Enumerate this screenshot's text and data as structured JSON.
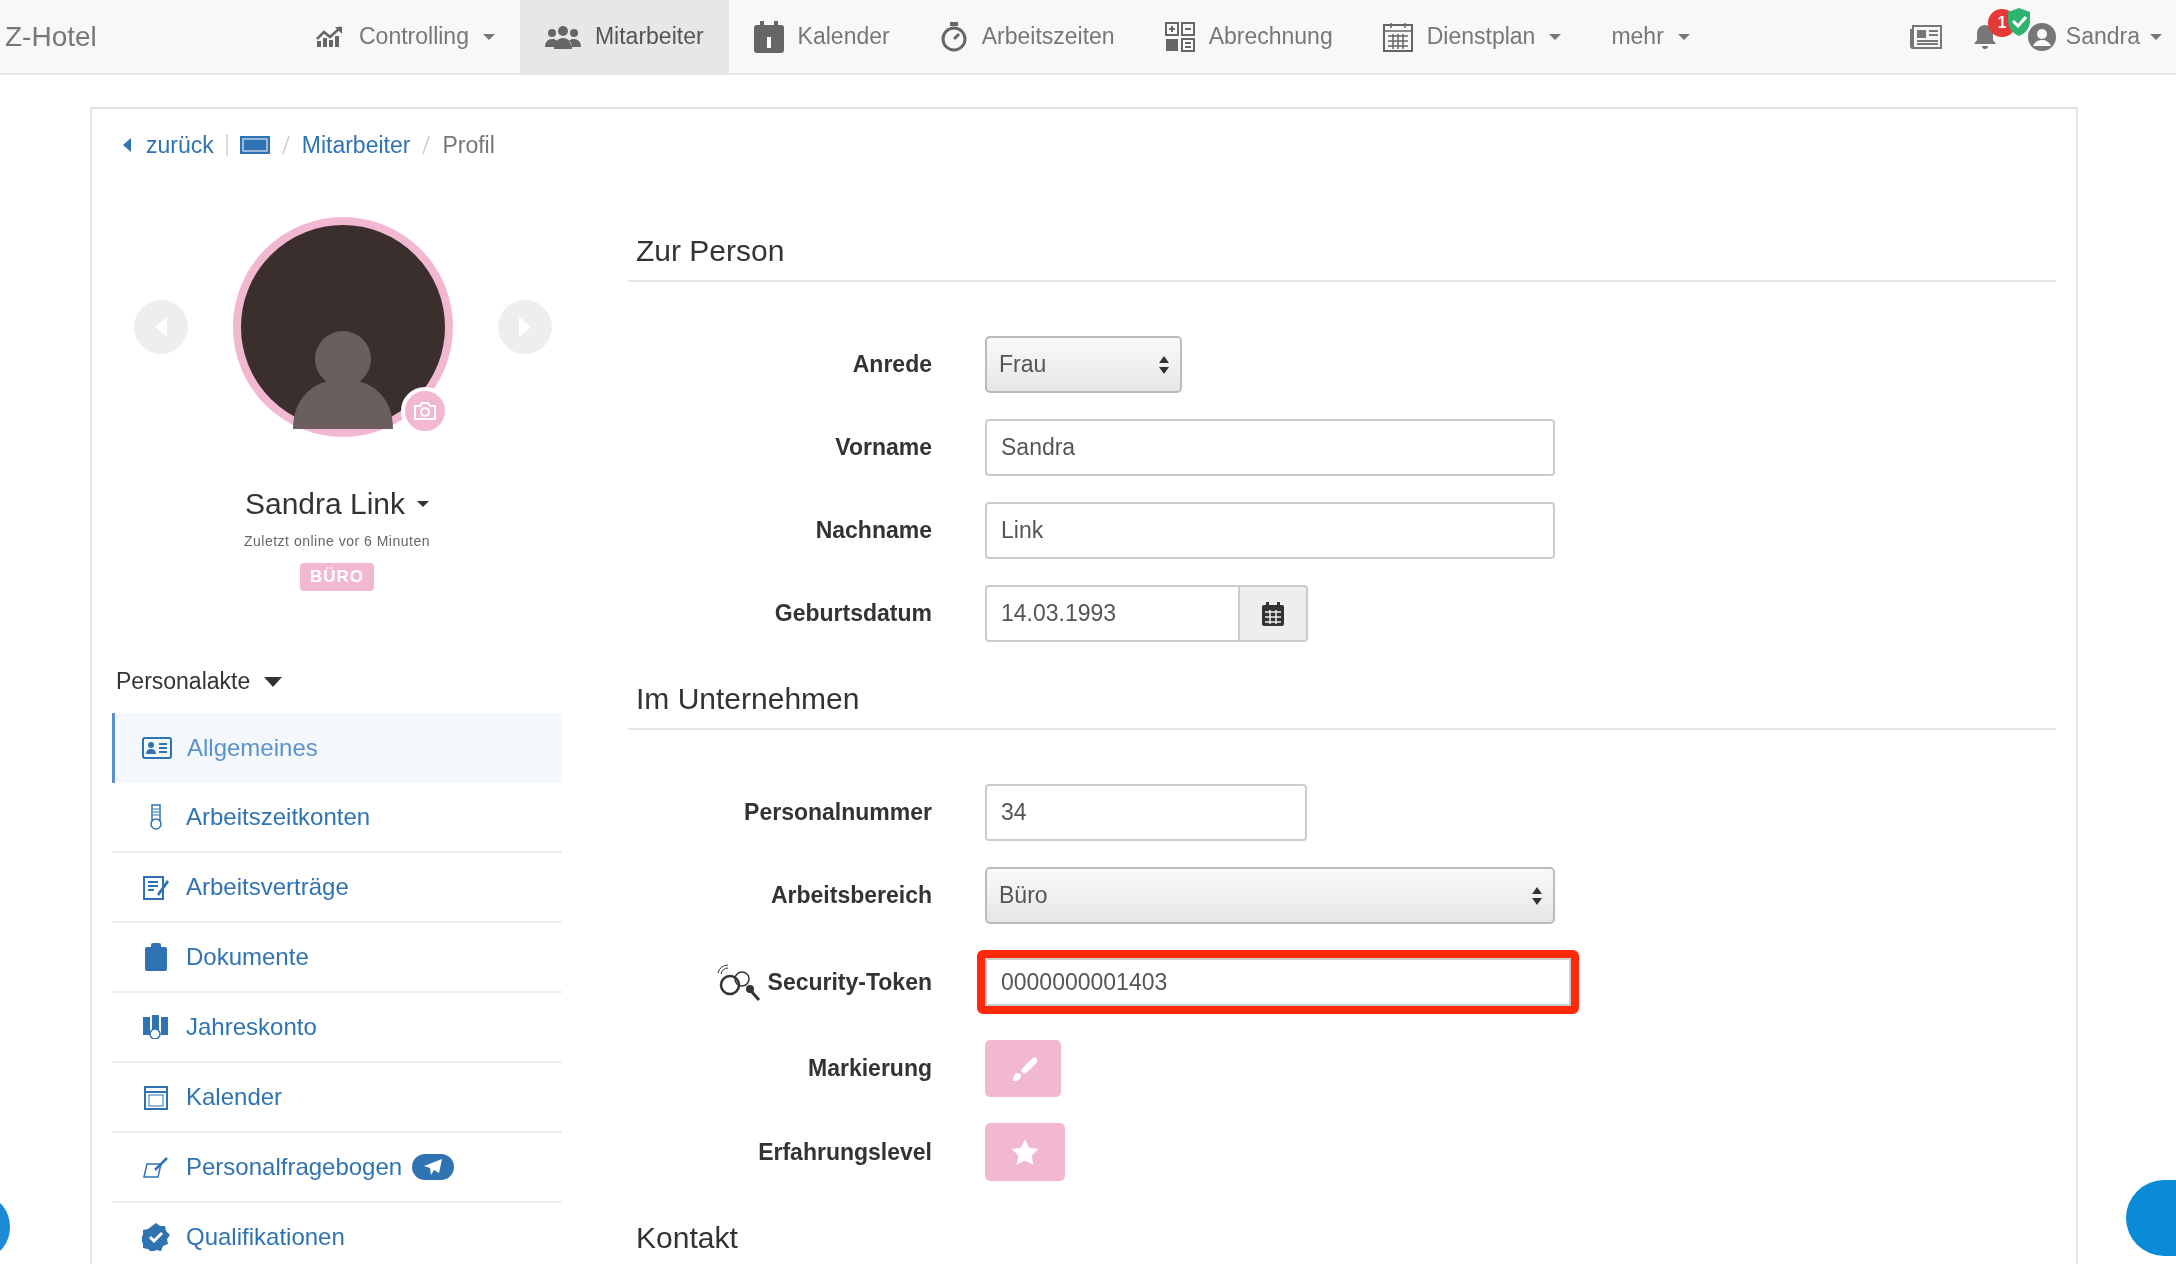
{
  "nav": {
    "brand": "Z-Hotel",
    "items": [
      {
        "label": "Controlling",
        "selected": false,
        "dropdown": true
      },
      {
        "label": "Mitarbeiter",
        "selected": true,
        "dropdown": false
      },
      {
        "label": "Kalender",
        "selected": false,
        "dropdown": false
      },
      {
        "label": "Arbeitszeiten",
        "selected": false,
        "dropdown": false
      },
      {
        "label": "Abrechnung",
        "selected": false,
        "dropdown": false
      },
      {
        "label": "Dienstplan",
        "selected": false,
        "dropdown": true
      },
      {
        "label": "mehr",
        "selected": false,
        "dropdown": true
      }
    ],
    "notification_count": "1",
    "user": "Sandra"
  },
  "breadcrumb": {
    "back": "zurück",
    "link": "Mitarbeiter",
    "current": "Profil"
  },
  "profile": {
    "name": "Sandra Link",
    "last_online": "Zuletzt online vor 6 Minuten",
    "badge": "BÜRO"
  },
  "personalakte": {
    "title": "Personalakte",
    "items": [
      {
        "label": "Allgemeines",
        "selected": true,
        "send_badge": false
      },
      {
        "label": "Arbeitszeitkonten",
        "selected": false,
        "send_badge": false
      },
      {
        "label": "Arbeitsverträge",
        "selected": false,
        "send_badge": false
      },
      {
        "label": "Dokumente",
        "selected": false,
        "send_badge": false
      },
      {
        "label": "Jahreskonto",
        "selected": false,
        "send_badge": false
      },
      {
        "label": "Kalender",
        "selected": false,
        "send_badge": false
      },
      {
        "label": "Personalfragebogen",
        "selected": false,
        "send_badge": true
      },
      {
        "label": "Qualifikationen",
        "selected": false,
        "send_badge": false
      }
    ]
  },
  "sections": [
    {
      "title": "Zur Person",
      "fields": [
        {
          "kind": "select-small",
          "label": "Anrede",
          "value": "Frau"
        },
        {
          "kind": "text",
          "label": "Vorname",
          "value": "Sandra"
        },
        {
          "kind": "text",
          "label": "Nachname",
          "value": "Link"
        },
        {
          "kind": "date",
          "label": "Geburtsdatum",
          "value": "14.03.1993"
        }
      ]
    },
    {
      "title": "Im Unternehmen",
      "fields": [
        {
          "kind": "text-short",
          "label": "Personalnummer",
          "value": "34"
        },
        {
          "kind": "select",
          "label": "Arbeitsbereich",
          "value": "Büro"
        },
        {
          "kind": "token",
          "label": "Security-Token",
          "value": "0000000001403"
        },
        {
          "kind": "color",
          "label": "Markierung",
          "color": "#f2b8d2"
        },
        {
          "kind": "level",
          "label": "Erfahrungslevel"
        }
      ]
    },
    {
      "title": "Kontakt"
    }
  ]
}
